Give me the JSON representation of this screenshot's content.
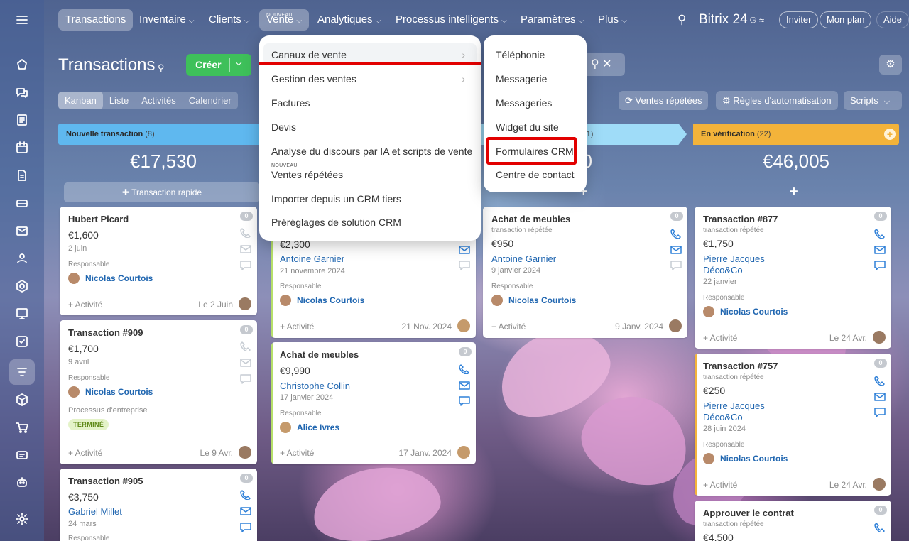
{
  "nav": {
    "menu_icon": "hamburger-icon",
    "items": [
      {
        "label": "Transactions"
      },
      {
        "label": "Inventaire"
      },
      {
        "label": "Clients"
      },
      {
        "label": "Vente",
        "badge": "NOUVEAU"
      },
      {
        "label": "Analytiques"
      },
      {
        "label": "Processus intelligents"
      },
      {
        "label": "Paramètres"
      },
      {
        "label": "Plus"
      }
    ],
    "brand": "Bitrix 24",
    "invite": "Inviter",
    "plan": "Mon plan",
    "help": "Aide"
  },
  "header": {
    "title": "Transactions",
    "create": "Créer",
    "tabs": [
      "Kanban",
      "Liste",
      "Activités",
      "Calendrier"
    ],
    "repeat_sales": "Ventes répétées",
    "automation": "Règles d'automatisation",
    "scripts": "Scripts"
  },
  "columns": [
    {
      "title": "Nouvelle transaction",
      "count": "(8)",
      "sum": "€17,530",
      "quick": "Transaction rapide",
      "color": "#5fb8ef"
    },
    {
      "title": "",
      "count": "(1)",
      "sum": "50",
      "color": "#9fdcf8"
    },
    {
      "title": "En vérification",
      "count": "(22)",
      "sum": "€46,005",
      "color": "#f3b33a"
    }
  ],
  "cards": {
    "c1": {
      "title": "Hubert Picard",
      "amount": "€1,600",
      "sub": "2 juin",
      "resp_label": "Responsable",
      "person": "Nicolas Courtois",
      "activity": "+ Activité",
      "date": "Le 2 Juin",
      "count": "0"
    },
    "c2": {
      "title": "Transaction #909",
      "amount": "€1,700",
      "sub": "9 avril",
      "resp_label": "Responsable",
      "person": "Nicolas Courtois",
      "process": "Processus d'entreprise",
      "status": "TERMINÉ",
      "activity": "+ Activité",
      "date": "Le 9 Avr.",
      "count": "0"
    },
    "c3": {
      "title": "Transaction #905",
      "amount": "€3,750",
      "link": "Gabriel Millet",
      "sub": "24 mars",
      "resp_label": "Responsable",
      "count": "0"
    },
    "c4": {
      "amount": "€2,300",
      "link": "Antoine Garnier",
      "sub": "21 novembre 2024",
      "resp_label": "Responsable",
      "person": "Nicolas Courtois",
      "activity": "+ Activité",
      "date": "21 Nov. 2024"
    },
    "c5": {
      "title": "Achat de meubles",
      "amount": "€9,990",
      "link": "Christophe Collin",
      "sub": "17 janvier 2024",
      "resp_label": "Responsable",
      "person": "Alice Ivres",
      "activity": "+ Activité",
      "date": "17 Janv. 2024",
      "count": "0"
    },
    "c6": {
      "title": "Achat de meubles",
      "tag": "transaction répétée",
      "amount": "€950",
      "link": "Antoine Garnier",
      "sub": "9 janvier 2024",
      "resp_label": "Responsable",
      "person": "Nicolas Courtois",
      "activity": "+ Activité",
      "date": "9 Janv. 2024",
      "count": "0"
    },
    "c7": {
      "title": "Transaction #877",
      "tag": "transaction répétée",
      "amount": "€1,750",
      "link": "Pierre Jacques",
      "link2": "Déco&Co",
      "sub": "22 janvier",
      "resp_label": "Responsable",
      "person": "Nicolas Courtois",
      "activity": "+ Activité",
      "date": "Le 24 Avr.",
      "count": "0"
    },
    "c8": {
      "title": "Transaction #757",
      "tag": "transaction répétée",
      "amount": "€250",
      "link": "Pierre Jacques",
      "link2": "Déco&Co",
      "sub": "28 juin 2024",
      "resp_label": "Responsable",
      "person": "Nicolas Courtois",
      "activity": "+ Activité",
      "date": "Le 24 Avr.",
      "count": "0"
    },
    "c9": {
      "title": "Approuver le contrat",
      "tag": "transaction répétée",
      "amount": "€4,500",
      "count": "0"
    }
  },
  "menu": {
    "items": [
      "Canaux de vente",
      "Gestion des ventes",
      "Factures",
      "Devis",
      "Analyse du discours par IA et scripts de vente",
      "Ventes répétées",
      "Importer depuis un CRM tiers",
      "Préréglages de solution CRM"
    ],
    "new_badge": "NOUVEAU"
  },
  "submenu": {
    "items": [
      "Téléphonie",
      "Messagerie",
      "Messageries",
      "Widget du site",
      "Formulaires CRM",
      "Centre de contact"
    ]
  },
  "colors": {
    "accent_red": "#e20000",
    "create_green": "#3ec05a",
    "link_blue": "#2066b0"
  }
}
